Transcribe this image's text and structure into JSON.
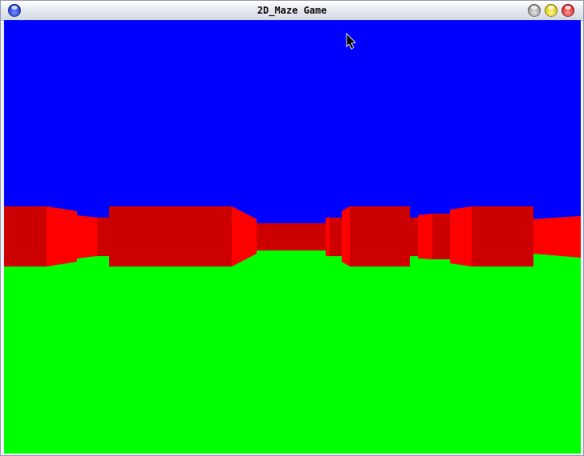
{
  "window": {
    "title": "2D_Maze Game"
  },
  "colors": {
    "sky": "#0000ff",
    "floor": "#00ff00",
    "wall_front": "#cc0000",
    "wall_side": "#ff0000",
    "title_text": "#111111"
  },
  "icons": {
    "menu": "blue-orb-icon",
    "minimize": "gray-orb-icon",
    "maximize": "yellow-orb-icon",
    "close": "red-orb-icon",
    "cursor": "mouse-pointer-icon"
  }
}
